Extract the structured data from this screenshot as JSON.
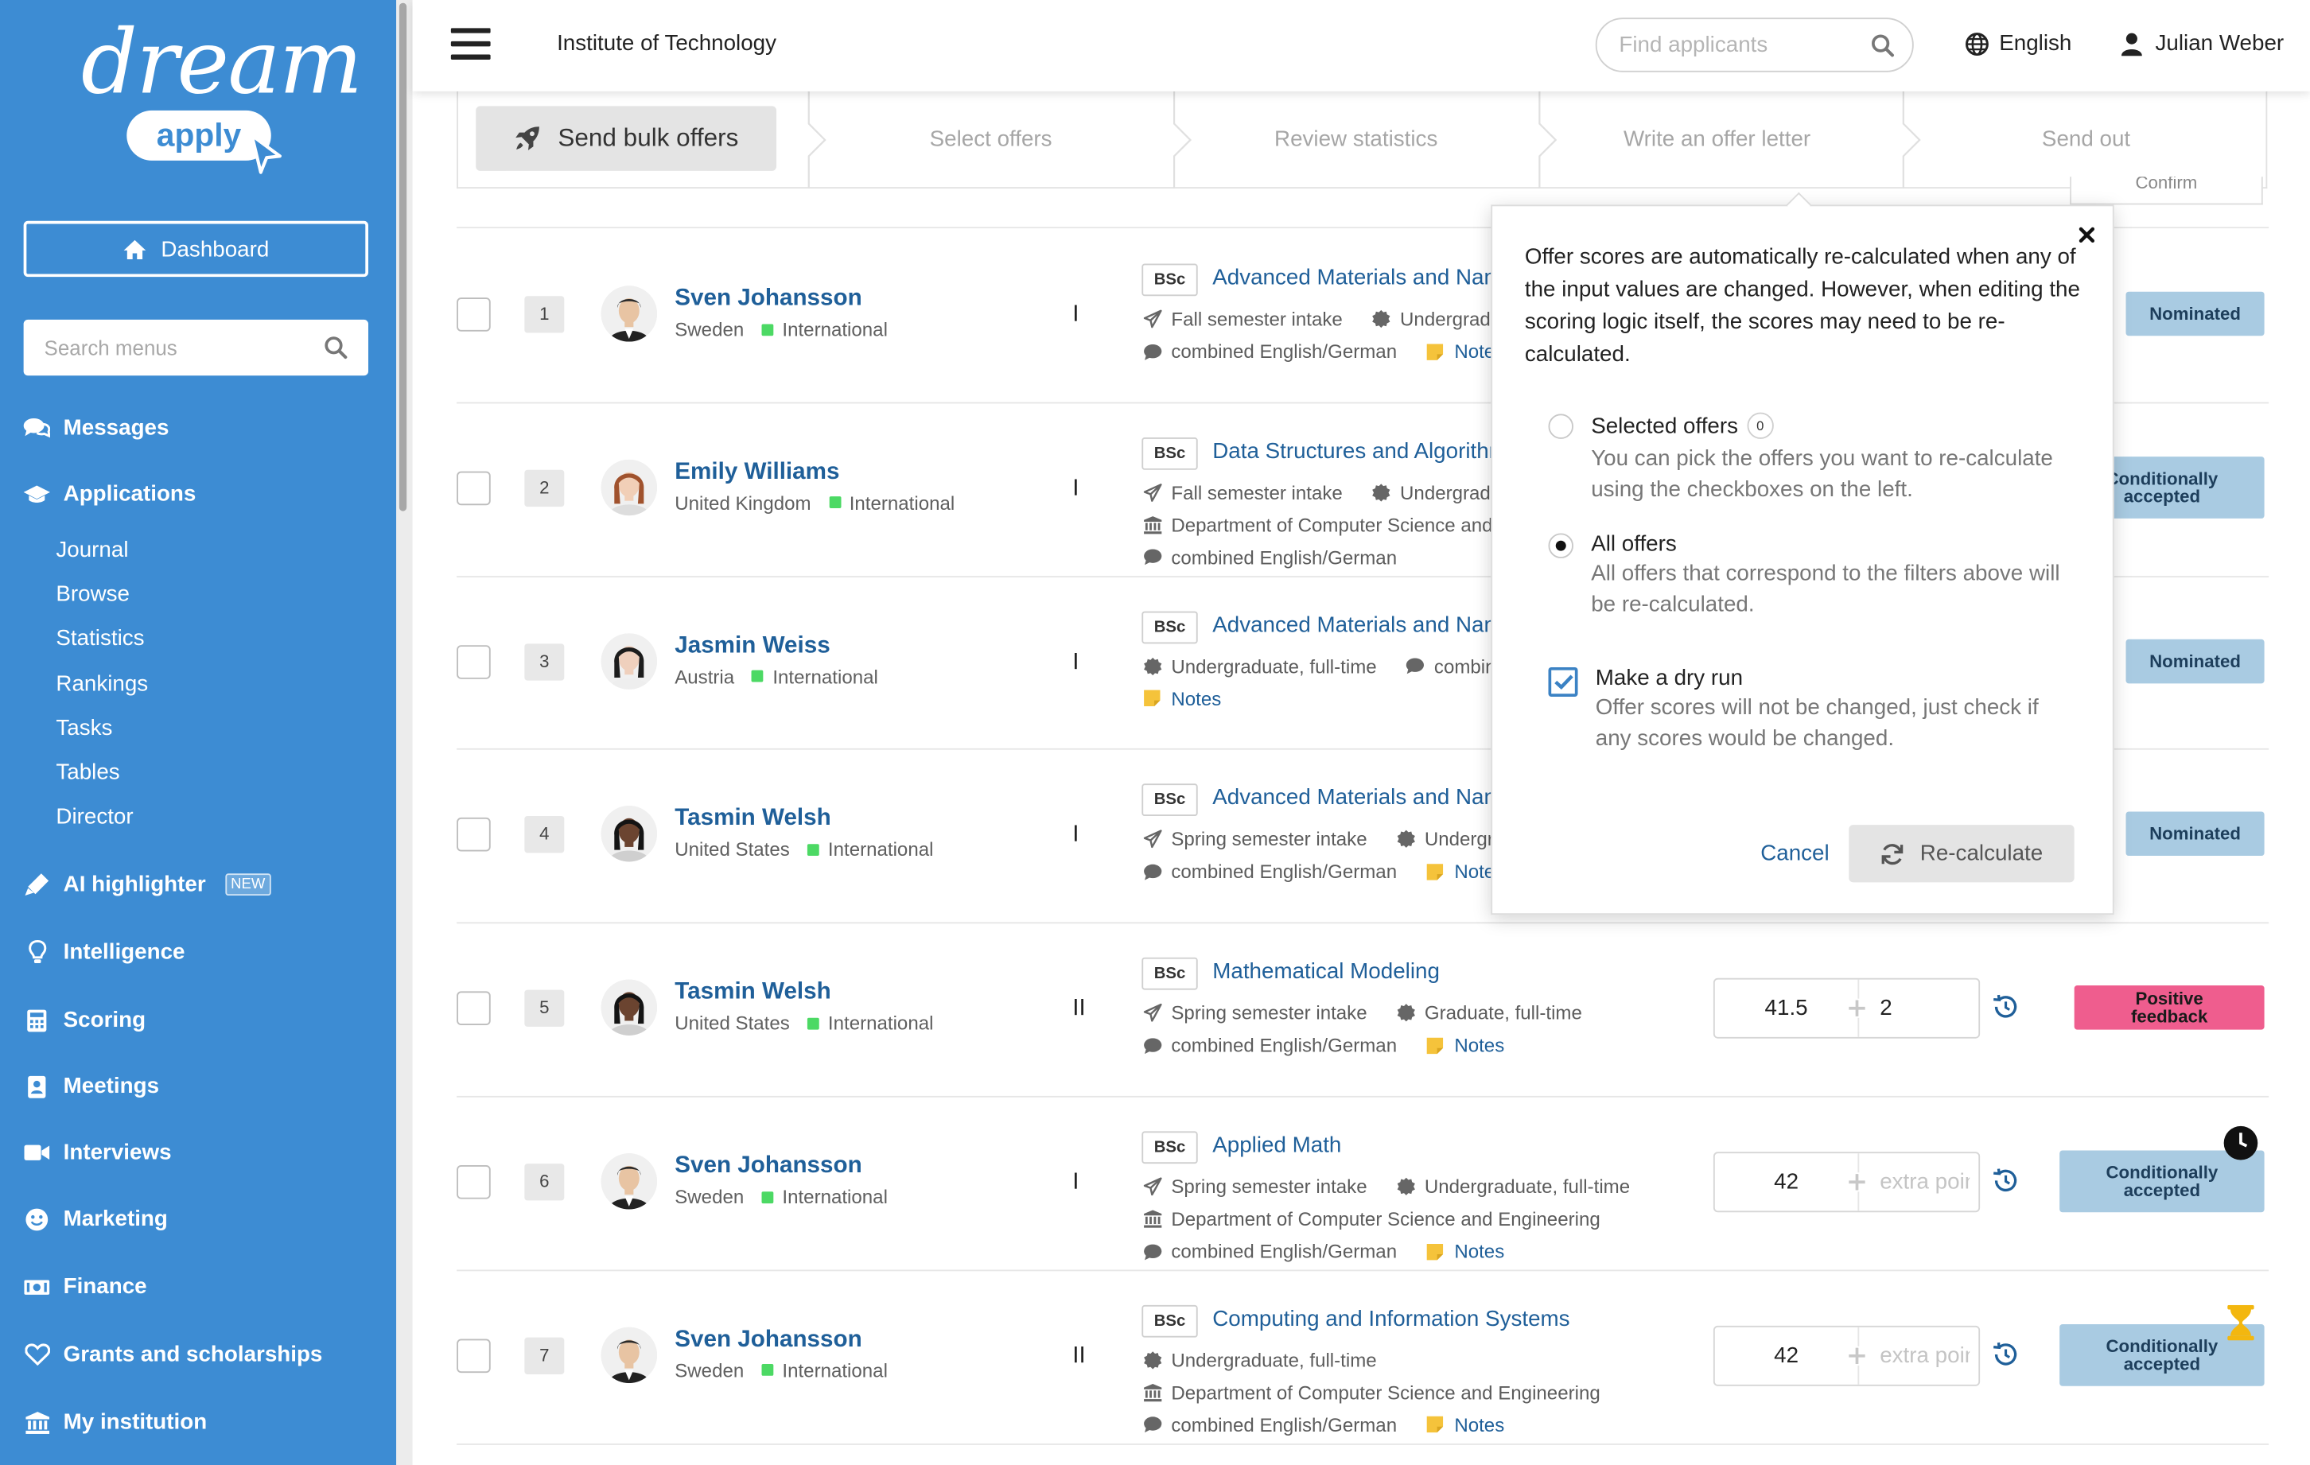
{
  "sidebar": {
    "logo_main": "dream",
    "logo_sub": "apply",
    "dashboard_label": "Dashboard",
    "search_placeholder": "Search menus",
    "nav": [
      {
        "label": "Messages",
        "icon": "comments-icon"
      },
      {
        "label": "Applications",
        "icon": "graduation-cap-icon"
      },
      {
        "label": "AI highlighter",
        "icon": "highlighter-icon",
        "badge": "NEW"
      },
      {
        "label": "Intelligence",
        "icon": "lightbulb-icon"
      },
      {
        "label": "Scoring",
        "icon": "calculator-icon"
      },
      {
        "label": "Meetings",
        "icon": "address-book-icon"
      },
      {
        "label": "Interviews",
        "icon": "video-camera-icon"
      },
      {
        "label": "Marketing",
        "icon": "smile-icon"
      },
      {
        "label": "Finance",
        "icon": "money-bill-icon"
      },
      {
        "label": "Grants and scholarships",
        "icon": "heart-icon"
      },
      {
        "label": "My institution",
        "icon": "university-icon"
      }
    ],
    "applications_sub": [
      "Journal",
      "Browse",
      "Statistics",
      "Rankings",
      "Tasks",
      "Tables",
      "Director"
    ]
  },
  "topbar": {
    "institution": "Institute of Technology",
    "search_placeholder": "Find applicants",
    "language": "English",
    "user": "Julian Weber"
  },
  "stepper": {
    "active": "Send bulk offers",
    "steps": [
      "Select offers",
      "Review statistics",
      "Write an offer letter",
      "Send out"
    ],
    "peek": "Confirm"
  },
  "rows": [
    {
      "num": "1",
      "name": "Sven Johansson",
      "country": "Sweden",
      "type": "International",
      "avatar": "male",
      "roman": "I",
      "degree": "BSc",
      "program": "Advanced Materials and Nanotechnology",
      "line1": [
        "Fall semester intake",
        "Undergraduate, full-time"
      ],
      "line2": "",
      "line3": "combined English/German",
      "notes": "Notes",
      "score": "",
      "extra": "",
      "status": "Nominated",
      "status_color": "#a9cbe2"
    },
    {
      "num": "2",
      "name": "Emily Williams",
      "country": "United Kingdom",
      "type": "International",
      "avatar": "female",
      "roman": "I",
      "degree": "BSc",
      "program": "Data Structures and Algorithms",
      "line1": [
        "Fall semester intake",
        "Undergraduate, full-time"
      ],
      "line2": "Department of Computer Science and Engineering",
      "line3": "combined English/German",
      "notes": "",
      "score": "",
      "extra": "",
      "status": "Conditionally accepted",
      "status_color": "#a9cbe2"
    },
    {
      "num": "3",
      "name": "Jasmin Weiss",
      "country": "Austria",
      "type": "International",
      "avatar": "female2",
      "roman": "I",
      "degree": "BSc",
      "program": "Advanced Materials and Nanotechnology",
      "line1": [
        "Undergraduate, full-time",
        "combined English/German"
      ],
      "line2": "",
      "line3": "",
      "notes": "Notes",
      "score": "",
      "extra": "",
      "status": "Nominated",
      "status_color": "#a9cbe2"
    },
    {
      "num": "4",
      "name": "Tasmin Welsh",
      "country": "United States",
      "type": "International",
      "avatar": "female3",
      "roman": "I",
      "degree": "BSc",
      "program": "Advanced Materials and Nanotechnology",
      "line1": [
        "Spring semester intake",
        "Undergraduate, full-time"
      ],
      "line2": "",
      "line3": "combined English/German",
      "notes": "Notes",
      "score": "",
      "extra": "",
      "status": "Nominated",
      "status_color": "#a9cbe2"
    },
    {
      "num": "5",
      "name": "Tasmin Welsh",
      "country": "United States",
      "type": "International",
      "avatar": "female3",
      "roman": "II",
      "degree": "BSc",
      "program": "Mathematical Modeling",
      "line1": [
        "Spring semester intake",
        "Graduate, full-time"
      ],
      "line2": "",
      "line3": "combined English/German",
      "notes": "Notes",
      "score": "41.5",
      "extra": "2",
      "status": "Positive feedback",
      "status_color": "#ef5d8e"
    },
    {
      "num": "6",
      "name": "Sven Johansson",
      "country": "Sweden",
      "type": "International",
      "avatar": "male",
      "roman": "I",
      "degree": "BSc",
      "program": "Applied Math",
      "line1": [
        "Spring semester intake",
        "Undergraduate, full-time"
      ],
      "line2": "Department of Computer Science and Engineering",
      "line3": "combined English/German",
      "notes": "Notes",
      "score": "42",
      "extra": "extra points",
      "status": "Conditionally accepted",
      "status_color": "#a9cbe2"
    },
    {
      "num": "7",
      "name": "Sven Johansson",
      "country": "Sweden",
      "type": "International",
      "avatar": "male",
      "roman": "II",
      "degree": "BSc",
      "program": "Computing and Information Systems",
      "line1": [
        "Undergraduate, full-time"
      ],
      "line2": "Department of Computer Science and Engineering",
      "line3": "combined English/German",
      "notes": "Notes",
      "score": "42",
      "extra": "extra points",
      "status": "Conditionally accepted",
      "status_color": "#a9cbe2"
    }
  ],
  "popup": {
    "intro": "Offer scores are automatically re-calculated when any of the input values are changed. However, when editing the scoring logic itself, the scores may need to be re-calculated.",
    "opt_selected_title": "Selected offers",
    "opt_selected_count": "0",
    "opt_selected_desc": "You can pick the offers you want to re-calculate using the checkboxes on the left.",
    "opt_all_title": "All offers",
    "opt_all_desc": "All offers that correspond to the filters above will be re-calculated.",
    "opt_dry_title": "Make a dry run",
    "opt_dry_desc": "Offer scores will not be changed, just check if any scores would be changed.",
    "cancel": "Cancel",
    "recalculate": "Re-calculate",
    "selected_option": "all",
    "dry_run_checked": true
  },
  "colors": {
    "sidebar": "#3d8cd3",
    "link": "#1f5f99",
    "status_blue": "#a9cbe2",
    "status_pink": "#ef5d8e"
  }
}
